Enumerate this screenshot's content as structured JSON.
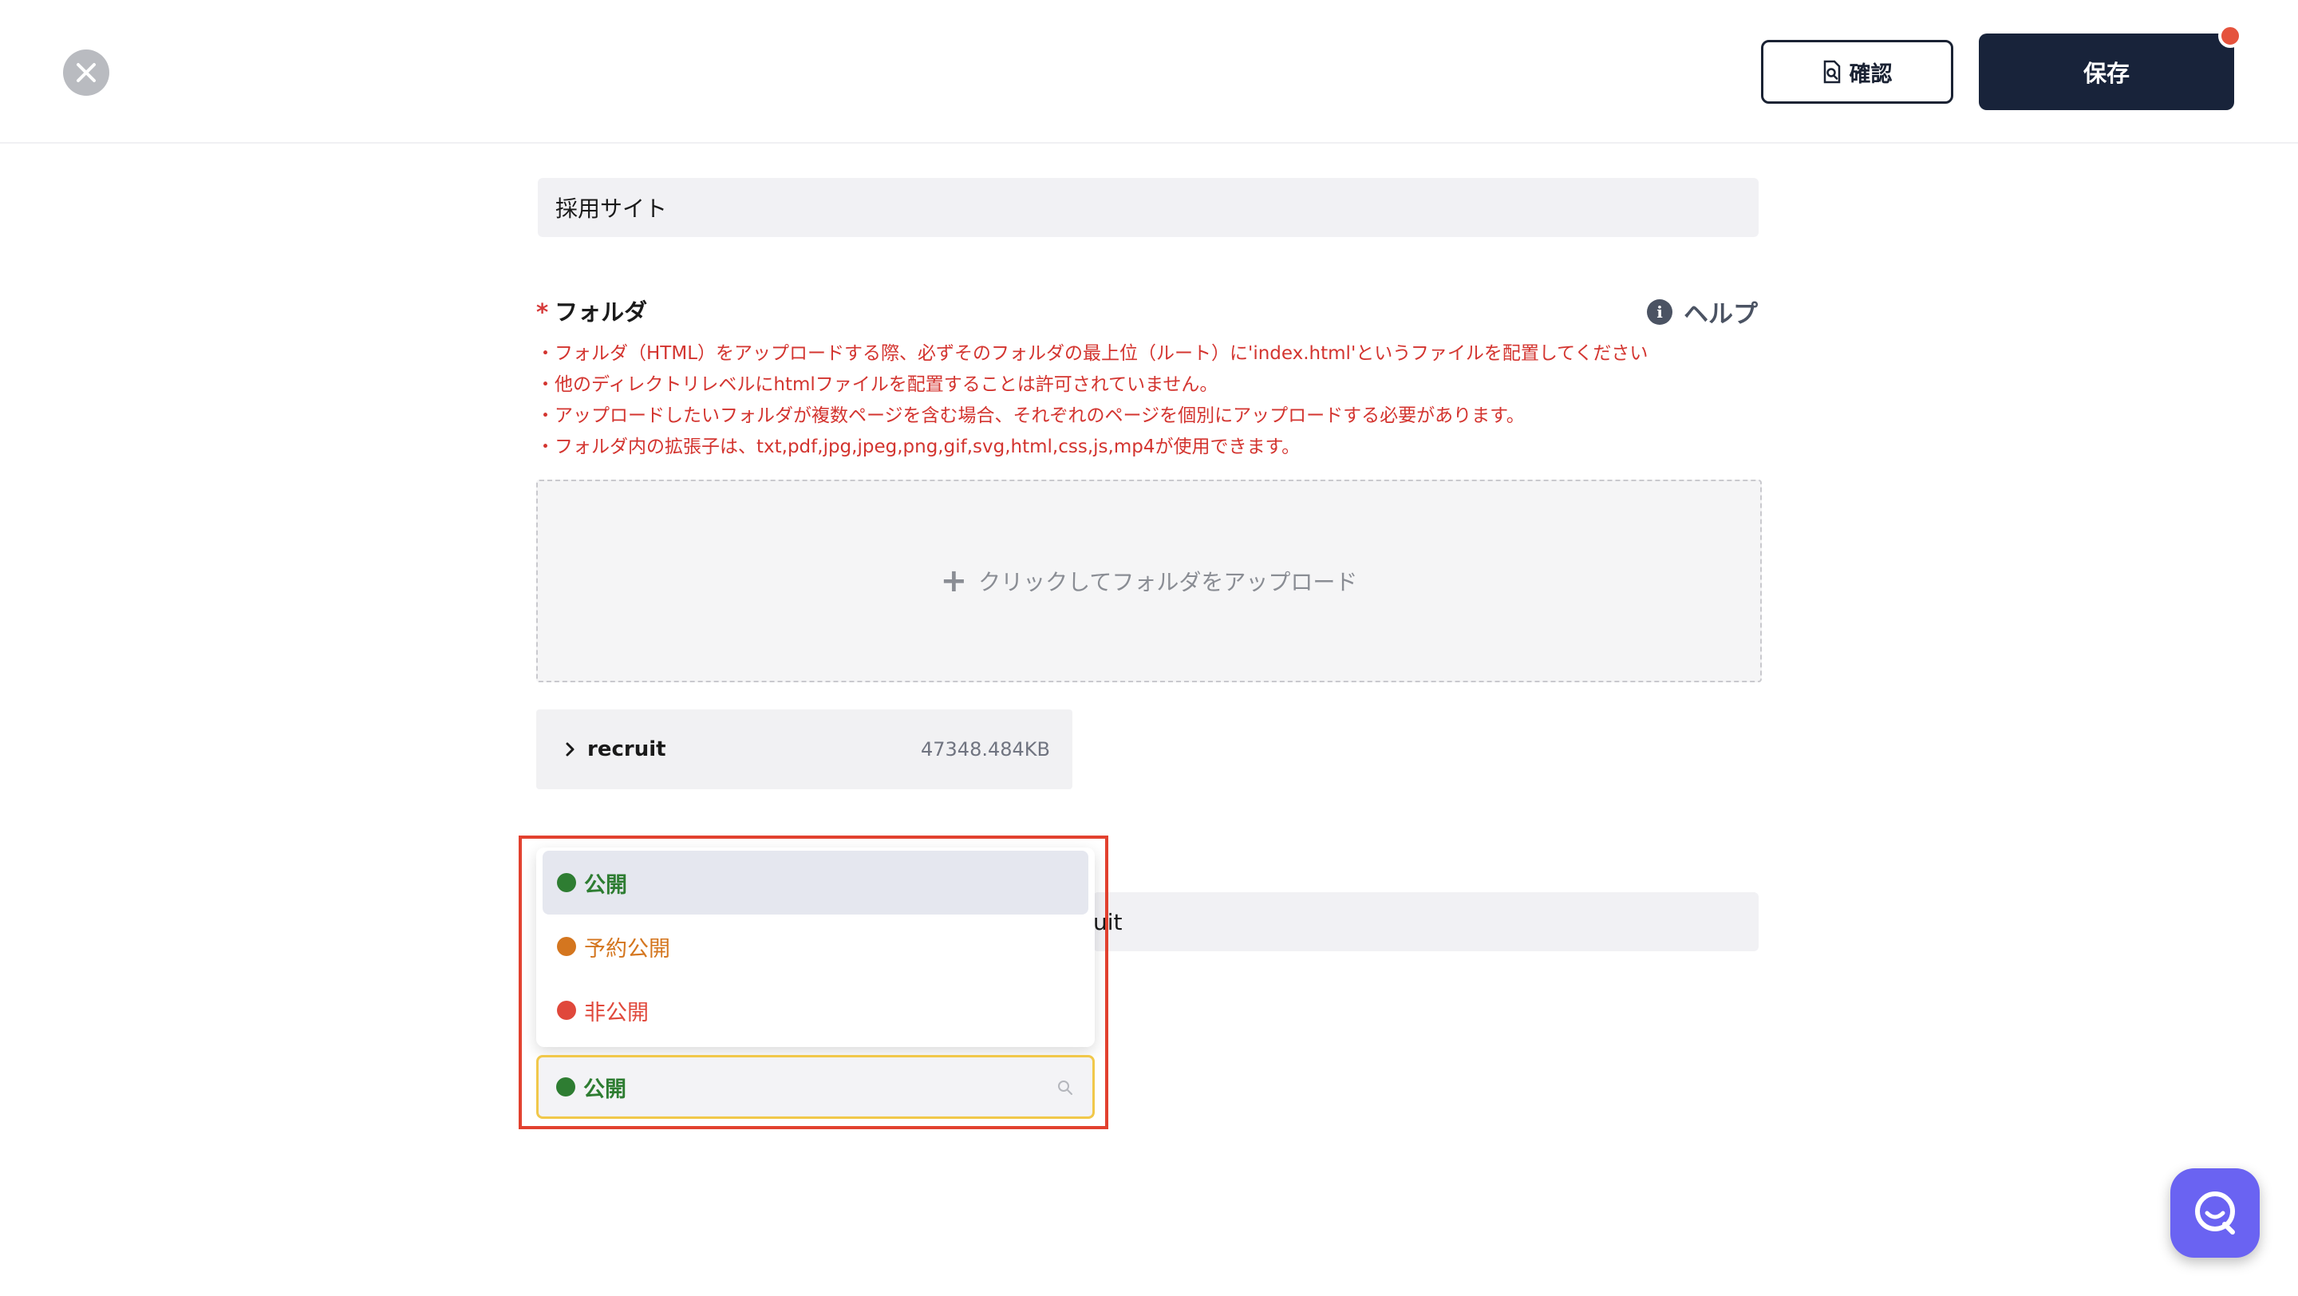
{
  "header": {
    "confirm_label": "確認",
    "save_label": "保存"
  },
  "site_name_field": {
    "value": "採用サイト"
  },
  "folder_section": {
    "label": "フォルダ",
    "required_mark": "*",
    "help_label": "ヘルプ",
    "notes": [
      "・フォルダ（HTML）をアップロードする際、必ずそのフォルダの最上位（ルート）に'index.html'というファイルを配置してください",
      "・他のディレクトリレベルにhtmlファイルを配置することは許可されていません。",
      "・アップロードしたいフォルダが複数ページを含む場合、それぞれのページを個別にアップロードする必要があります。",
      "・フォルダ内の拡張子は、txt,pdf,jpg,jpeg,png,gif,svg,html,css,js,mp4が使用できます。"
    ],
    "upload_label": "クリックしてフォルダをアップロード",
    "uploaded_folder": {
      "name": "recruit",
      "size": "47348.484KB"
    }
  },
  "background_field": {
    "value_partial": "uit"
  },
  "status_dropdown": {
    "options": [
      {
        "label": "公開",
        "color": "#2e7d32",
        "selected": true
      },
      {
        "label": "予約公開",
        "color": "#d4761f",
        "selected": false
      },
      {
        "label": "非公開",
        "color": "#e0483b",
        "selected": false
      }
    ],
    "current_value": "公開",
    "current_color": "#2e7d32"
  },
  "colors": {
    "accent_dark": "#18233a",
    "error_red": "#d3342f",
    "highlight_border": "#e2412f",
    "chat_purple": "#6a63f2"
  }
}
